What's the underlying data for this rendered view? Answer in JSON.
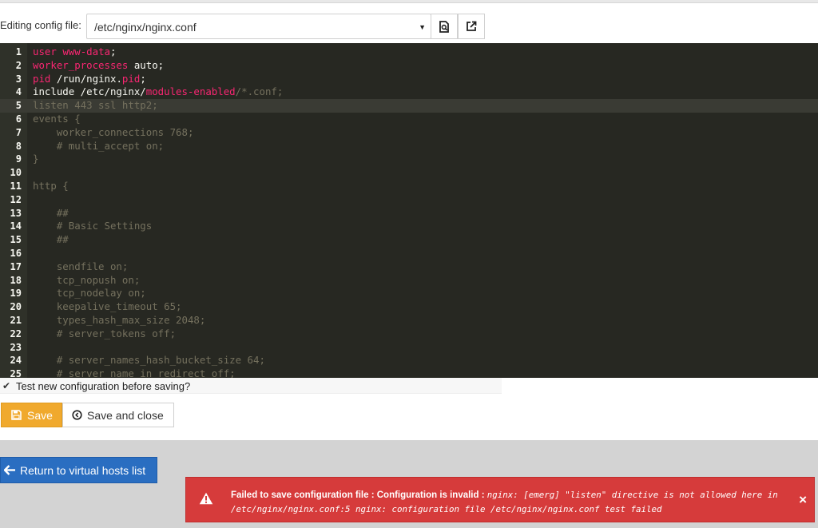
{
  "header": {
    "label": "Editing config file:",
    "file_value": "/etc/nginx/nginx.conf"
  },
  "editor": {
    "active_line": 5,
    "lines": [
      {
        "n": "1",
        "parts": [
          {
            "t": "user ",
            "c": "kw"
          },
          {
            "t": "www-data",
            "c": "kw"
          },
          {
            "t": ";",
            "c": "id"
          }
        ]
      },
      {
        "n": "2",
        "parts": [
          {
            "t": "worker_processes",
            "c": "kw"
          },
          {
            "t": " auto;",
            "c": "id"
          }
        ]
      },
      {
        "n": "3",
        "parts": [
          {
            "t": "pid",
            "c": "kw"
          },
          {
            "t": " /run/nginx.",
            "c": "id"
          },
          {
            "t": "pid",
            "c": "kw"
          },
          {
            "t": ";",
            "c": "id"
          }
        ]
      },
      {
        "n": "4",
        "parts": [
          {
            "t": "include /etc/nginx/",
            "c": "id"
          },
          {
            "t": "modules-enabled",
            "c": "kw"
          },
          {
            "t": "/*.conf;",
            "c": "muted"
          }
        ]
      },
      {
        "n": "5",
        "parts": [
          {
            "t": "listen 443 ssl http2;",
            "c": "muted"
          }
        ]
      },
      {
        "n": "6",
        "parts": [
          {
            "t": "events {",
            "c": "muted"
          }
        ]
      },
      {
        "n": "7",
        "parts": [
          {
            "t": "    worker_connections 768;",
            "c": "muted"
          }
        ]
      },
      {
        "n": "8",
        "parts": [
          {
            "t": "    # multi_accept on;",
            "c": "muted"
          }
        ]
      },
      {
        "n": "9",
        "parts": [
          {
            "t": "}",
            "c": "muted"
          }
        ]
      },
      {
        "n": "10",
        "parts": []
      },
      {
        "n": "11",
        "parts": [
          {
            "t": "http {",
            "c": "muted"
          }
        ]
      },
      {
        "n": "12",
        "parts": []
      },
      {
        "n": "13",
        "parts": [
          {
            "t": "    ##",
            "c": "muted"
          }
        ]
      },
      {
        "n": "14",
        "parts": [
          {
            "t": "    # Basic Settings",
            "c": "muted"
          }
        ]
      },
      {
        "n": "15",
        "parts": [
          {
            "t": "    ##",
            "c": "muted"
          }
        ]
      },
      {
        "n": "16",
        "parts": []
      },
      {
        "n": "17",
        "parts": [
          {
            "t": "    sendfile on;",
            "c": "muted"
          }
        ]
      },
      {
        "n": "18",
        "parts": [
          {
            "t": "    tcp_nopush on;",
            "c": "muted"
          }
        ]
      },
      {
        "n": "19",
        "parts": [
          {
            "t": "    tcp_nodelay on;",
            "c": "muted"
          }
        ]
      },
      {
        "n": "20",
        "parts": [
          {
            "t": "    keepalive_timeout 65;",
            "c": "muted"
          }
        ]
      },
      {
        "n": "21",
        "parts": [
          {
            "t": "    types_hash_max_size 2048;",
            "c": "muted"
          }
        ]
      },
      {
        "n": "22",
        "parts": [
          {
            "t": "    # server_tokens off;",
            "c": "muted"
          }
        ]
      },
      {
        "n": "23",
        "parts": []
      },
      {
        "n": "24",
        "parts": [
          {
            "t": "    # server_names_hash_bucket_size 64;",
            "c": "muted"
          }
        ]
      },
      {
        "n": "25",
        "parts": [
          {
            "t": "    # server_name_in_redirect off;",
            "c": "muted"
          }
        ]
      }
    ]
  },
  "test_option": {
    "checked": true,
    "label": "Test new configuration before saving?"
  },
  "actions": {
    "save_label": "Save",
    "save_close_label": "Save and close",
    "return_label": "Return to virtual hosts list"
  },
  "alert": {
    "title": "Failed to save configuration file : Configuration is invalid :",
    "detail": "nginx: [emerg] \"listen\" directive is not allowed here in /etc/nginx/nginx.conf:5 nginx: configuration file /etc/nginx/nginx.conf test failed",
    "close": "×"
  },
  "colors": {
    "accent_save": "#f0a92d",
    "accent_return": "#2a6ec1",
    "alert_bg": "#d63b3b",
    "editor_bg": "#272822"
  }
}
